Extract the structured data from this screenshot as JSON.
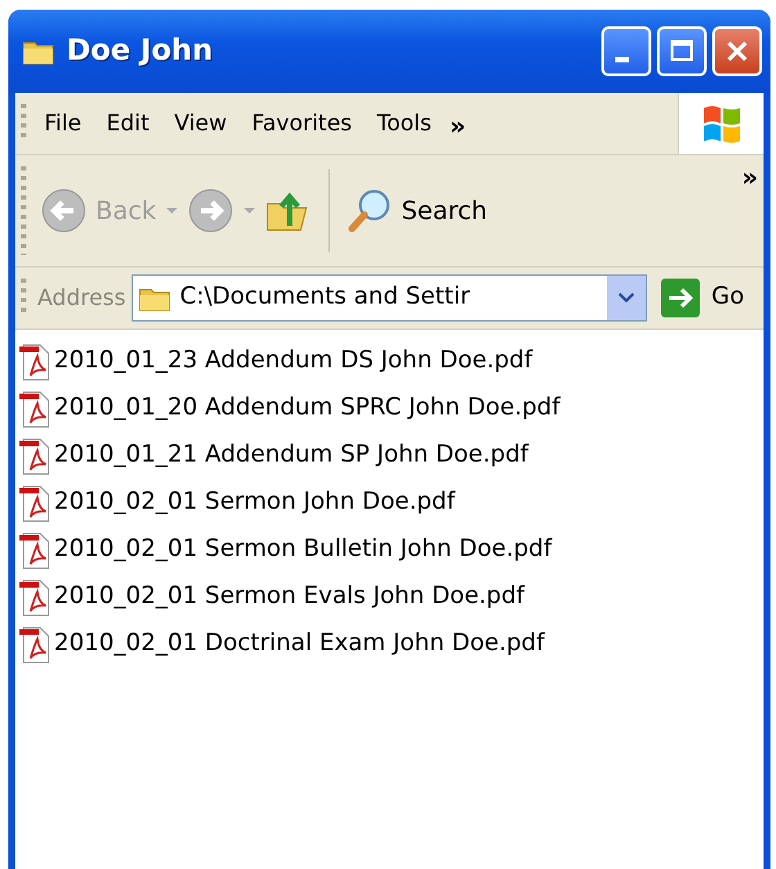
{
  "window": {
    "title": "Doe John"
  },
  "menu": [
    {
      "label": "File"
    },
    {
      "label": "Edit"
    },
    {
      "label": "View"
    },
    {
      "label": "Favorites"
    },
    {
      "label": "Tools"
    }
  ],
  "menu_overflow": "»",
  "toolbar": [
    {
      "kind": "back",
      "label": "Back",
      "disabled": true
    },
    {
      "kind": "forward",
      "disabled": true
    },
    {
      "kind": "up",
      "disabled": false
    },
    {
      "kind": "search",
      "label": "Search",
      "disabled": false
    }
  ],
  "toolbar_overflow": "»",
  "address": {
    "label": "Address",
    "value": "C:\\Documents and Settir",
    "go": "Go"
  },
  "files": [
    {
      "name": "2010_01_23 Addendum DS John Doe.pdf"
    },
    {
      "name": "2010_01_20 Addendum SPRC John Doe.pdf"
    },
    {
      "name": "2010_01_21 Addendum SP John Doe.pdf"
    },
    {
      "name": "2010_02_01 Sermon John Doe.pdf"
    },
    {
      "name": "2010_02_01 Sermon Bulletin John Doe.pdf"
    },
    {
      "name": "2010_02_01 Sermon Evals John Doe.pdf"
    },
    {
      "name": "2010_02_01 Doctrinal Exam John Doe.pdf"
    }
  ]
}
